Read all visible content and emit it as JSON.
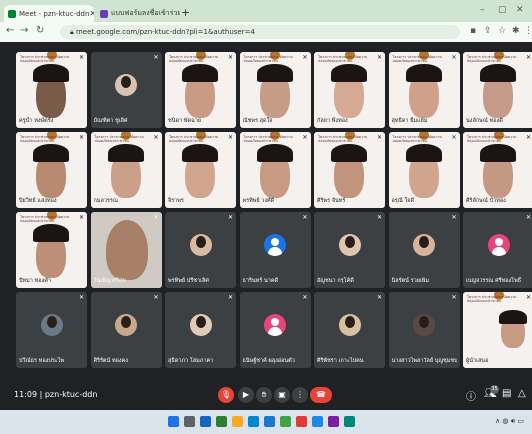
{
  "browser": {
    "tabs": [
      {
        "label": "Meet - pzn-ktuc-ddn",
        "active": true
      },
      {
        "label": "แบบฟอร์มลงชื่อเข้าร่วมกิจกรรม",
        "active": false
      }
    ],
    "url": "meet.google.com/pzn-ktuc-ddn?pli=1&authuser=4"
  },
  "meet": {
    "time": "11:09",
    "meeting_code": "pzn-ktuc-ddn",
    "participant_count": "35",
    "slide_header": "โครงการ ประชาคมอนามัยความปลอดภัยของประชาชน",
    "participants": [
      {
        "name": "ครูน้ำ หงษ์ตรัง",
        "type": "slide_face",
        "face": "#7a5a48"
      },
      {
        "name": "บัณฑิตา ชูเลิศ",
        "type": "photo_avatar",
        "face": "#d8c2b0"
      },
      {
        "name": "ชนิดา พัดฉาย",
        "type": "slide_face",
        "face": "#c99a84"
      },
      {
        "name": "ณัชพร สุดใจ",
        "type": "slide_face",
        "face": "#c79c86"
      },
      {
        "name": "กัลยา พึ่งทอง",
        "type": "slide_face",
        "face": "#d5a993"
      },
      {
        "name": "สุทธิดา ยิ้มแย้ม",
        "type": "slide_face",
        "face": "#d0a08a"
      },
      {
        "name": "นงลักษณ์ ทองดี",
        "type": "slide_face",
        "face": "#c69a88"
      },
      {
        "name": "ปิยวิทย์ แสงทอง",
        "type": "slide_face",
        "face": "#b88a70"
      },
      {
        "name": "กมลวรรณ",
        "type": "slide_face",
        "face": "#caa08a"
      },
      {
        "name": "จิราพร",
        "type": "slide_face",
        "face": "#d2a58f"
      },
      {
        "name": "พรทิพย์ วงศ์ดี",
        "type": "slide_face",
        "face": "#c89a84"
      },
      {
        "name": "ศิริพร จันทร์",
        "type": "slide_face",
        "face": "#c2947c"
      },
      {
        "name": "อรุณี ใจดี",
        "type": "slide_face",
        "face": "#d1a48e"
      },
      {
        "name": "ศิริลักษณ์ บัวทอง",
        "type": "slide_face",
        "face": "#c59883"
      },
      {
        "name": "ปัทมา ทองคำ",
        "type": "slide_face",
        "face": "#bd8f77"
      },
      {
        "name": "วันเพ็ญ ศรีสุข",
        "type": "camera_face",
        "face": "#a88068"
      },
      {
        "name": "พรทิพย์ ปรีชาเลิศ",
        "type": "photo_avatar",
        "face": "#d9b9a0"
      },
      {
        "name": "ธารินทร์ นาคดี",
        "type": "blue_avatar",
        "face": "#1a73e8"
      },
      {
        "name": "อัญชนา กรุโค้ดี",
        "type": "photo_avatar",
        "face": "#e1c4ad"
      },
      {
        "name": "นิลรัตน์ รวยเพิ่ม",
        "type": "photo_avatar",
        "face": "#d6b49c"
      },
      {
        "name": "เบญจวรรณ ศรีทองโพธิ์",
        "type": "pink_avatar",
        "face": "#e8457c"
      },
      {
        "name": "ปวีณ์ธร ทองประไพ",
        "type": "photo_avatar",
        "face": "#6a7a86"
      },
      {
        "name": "ศิริรัตน์ ทองคง",
        "type": "photo_avatar",
        "face": "#c9a789"
      },
      {
        "name": "สุธิดาภา โสมภาคา",
        "type": "photo_avatar",
        "face": "#e2cbb6"
      },
      {
        "name": "ธนิษฐ์ชาค์ ผลุงอ่อนตัว",
        "type": "pink_avatar",
        "face": "#e8457c"
      },
      {
        "name": "ศิริพัชรา เกาะไปคน",
        "type": "photo_avatar",
        "face": "#d8c09f"
      },
      {
        "name": "นางสาวไพลาวัลย์ บุญชุมชนสมุทร",
        "type": "photo_avatar",
        "face": "#5a4a44"
      },
      {
        "name": "ผู้นำเสนอ",
        "type": "slide_face_lg",
        "face": "#c89a84"
      }
    ]
  },
  "colors": {
    "meet_bg": "#202124",
    "tile_bg": "#3c4043",
    "end_call": "#ea4335",
    "mic_off": "#ea4335"
  },
  "icons": [
    "mic-off-icon",
    "camera-icon",
    "hand-icon",
    "present-icon",
    "more-icon",
    "end-call-icon",
    "info-icon",
    "people-icon",
    "chat-icon",
    "activities-icon"
  ]
}
